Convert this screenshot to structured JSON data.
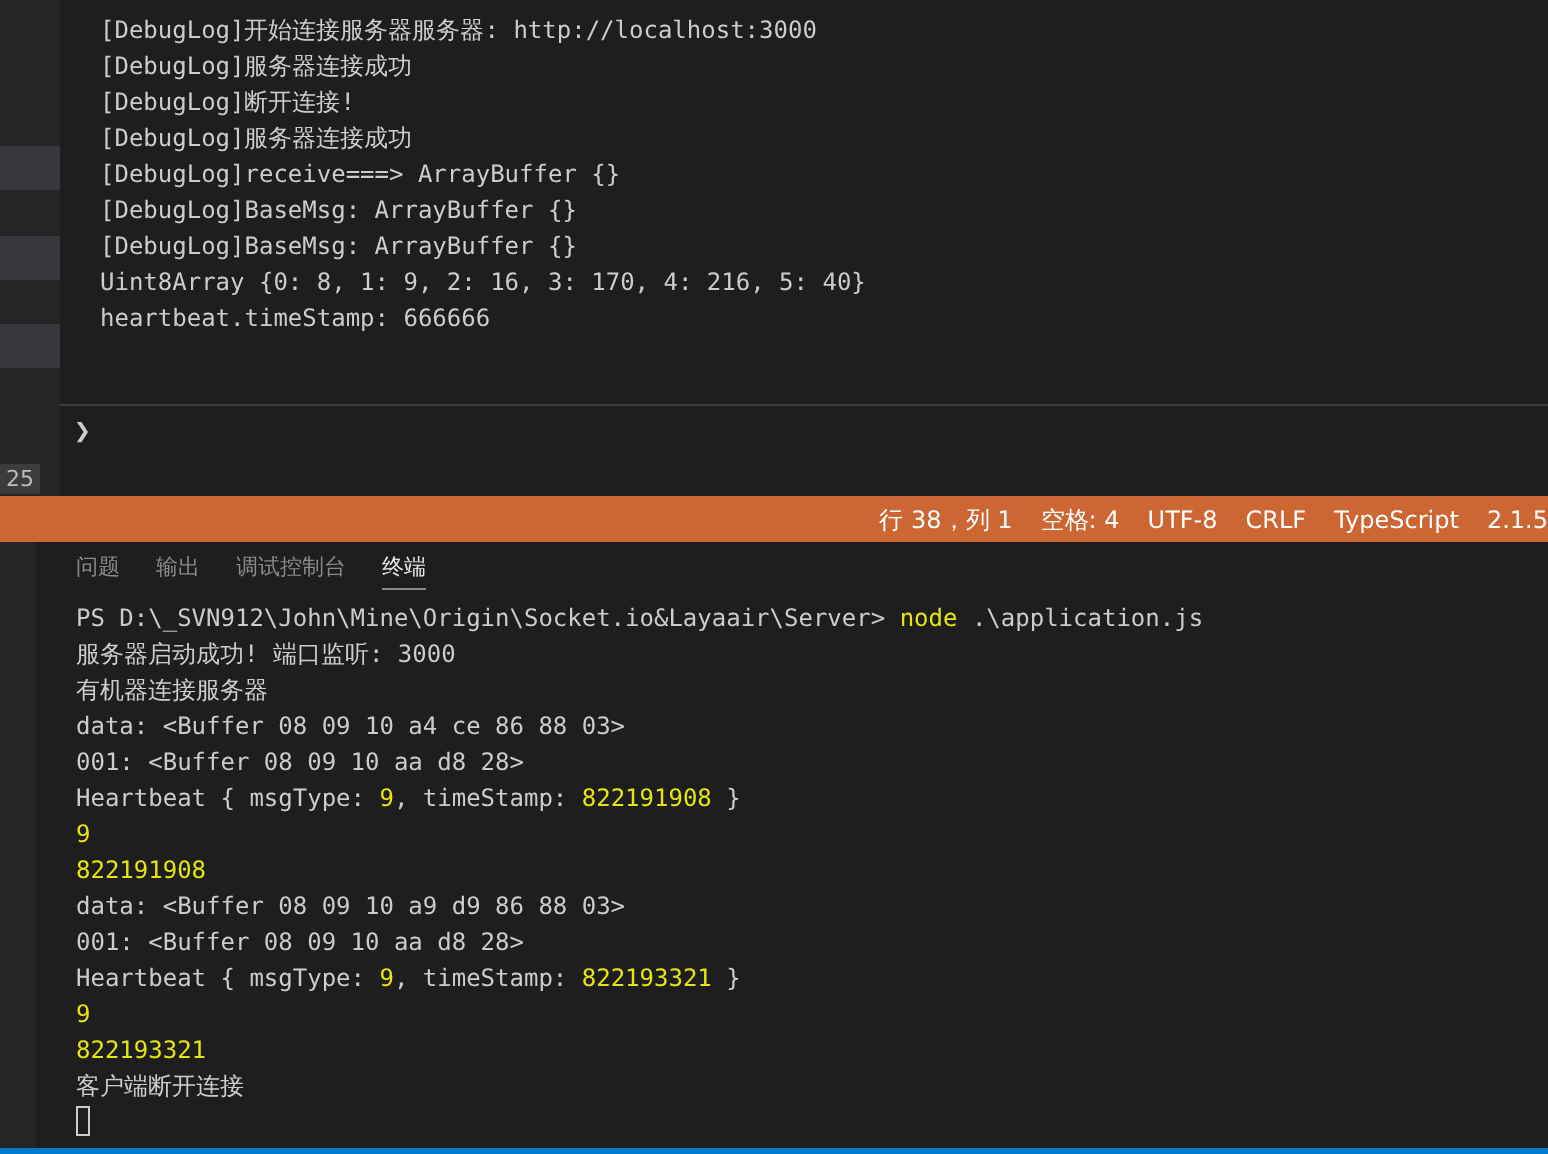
{
  "debug_console": {
    "lines": [
      "[DebugLog]开始连接服务器服务器: http://localhost:3000",
      "[DebugLog]服务器连接成功",
      "[DebugLog]断开连接!",
      "[DebugLog]服务器连接成功",
      "[DebugLog]receive===> ArrayBuffer {}",
      "[DebugLog]BaseMsg: ArrayBuffer {}",
      "[DebugLog]BaseMsg: ArrayBuffer {}",
      "Uint8Array {0: 8, 1: 9, 2: 16, 3: 170, 4: 216, 5: 40}",
      "heartbeat.timeStamp: 666666"
    ],
    "prompt": "❯",
    "line_badge": "25"
  },
  "status_bar": [
    "行 38，列 1",
    "空格: 4",
    "UTF-8",
    "CRLF",
    "TypeScript",
    "2.1.5"
  ],
  "panel_tabs": [
    {
      "label": "问题",
      "selected": false
    },
    {
      "label": "输出",
      "selected": false
    },
    {
      "label": "调试控制台",
      "selected": false
    },
    {
      "label": "终端",
      "selected": true
    }
  ],
  "terminal": {
    "lines": [
      {
        "segments": [
          {
            "text": "PS D:\\_SVN912\\John\\Mine\\Origin\\Socket.io&Layaair\\Server> ",
            "kind": "plain"
          },
          {
            "text": "node",
            "kind": "highlight"
          },
          {
            "text": " .\\application.js",
            "kind": "plain"
          }
        ]
      },
      {
        "segments": [
          {
            "text": "服务器启动成功! 端口监听: 3000",
            "kind": "plain"
          }
        ]
      },
      {
        "segments": [
          {
            "text": "有机器连接服务器",
            "kind": "plain"
          }
        ]
      },
      {
        "segments": [
          {
            "text": "data: <Buffer 08 09 10 a4 ce 86 88 03>",
            "kind": "plain"
          }
        ]
      },
      {
        "segments": [
          {
            "text": "001: <Buffer 08 09 10 aa d8 28>",
            "kind": "plain"
          }
        ]
      },
      {
        "segments": [
          {
            "text": "Heartbeat { msgType: ",
            "kind": "plain"
          },
          {
            "text": "9",
            "kind": "highlight"
          },
          {
            "text": ", timeStamp: ",
            "kind": "plain"
          },
          {
            "text": "822191908",
            "kind": "highlight"
          },
          {
            "text": " }",
            "kind": "plain"
          }
        ]
      },
      {
        "segments": [
          {
            "text": "9",
            "kind": "highlight"
          }
        ]
      },
      {
        "segments": [
          {
            "text": "822191908",
            "kind": "highlight"
          }
        ]
      },
      {
        "segments": [
          {
            "text": "data: <Buffer 08 09 10 a9 d9 86 88 03>",
            "kind": "plain"
          }
        ]
      },
      {
        "segments": [
          {
            "text": "001: <Buffer 08 09 10 aa d8 28>",
            "kind": "plain"
          }
        ]
      },
      {
        "segments": [
          {
            "text": "Heartbeat { msgType: ",
            "kind": "plain"
          },
          {
            "text": "9",
            "kind": "highlight"
          },
          {
            "text": ", timeStamp: ",
            "kind": "plain"
          },
          {
            "text": "822193321",
            "kind": "highlight"
          },
          {
            "text": " }",
            "kind": "plain"
          }
        ]
      },
      {
        "segments": [
          {
            "text": "9",
            "kind": "highlight"
          }
        ]
      },
      {
        "segments": [
          {
            "text": "822193321",
            "kind": "highlight"
          }
        ]
      },
      {
        "segments": [
          {
            "text": "客户端断开连接",
            "kind": "plain"
          }
        ]
      }
    ]
  }
}
